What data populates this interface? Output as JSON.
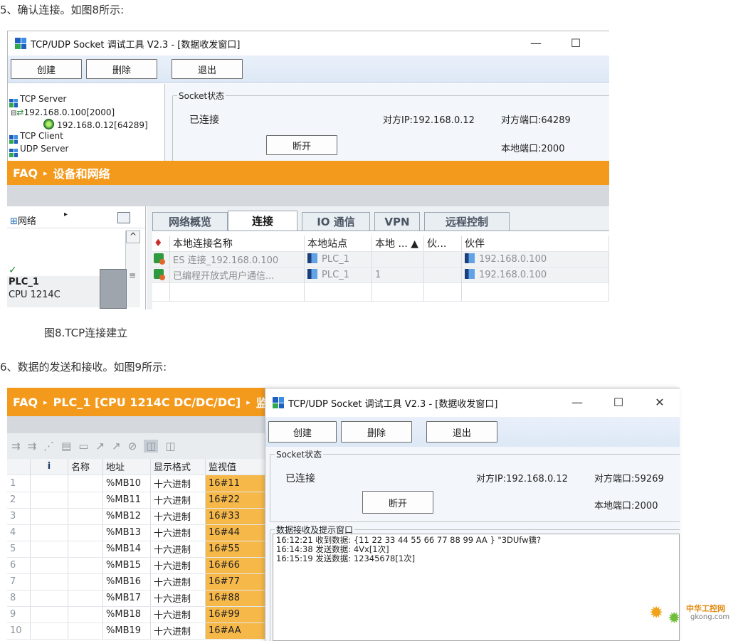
{
  "steps": {
    "step5": "5、确认连接。如图8所示:",
    "caption8": "图8.TCP连接建立",
    "step6": "6、数据的发送和接收。如图9所示:"
  },
  "fig8": {
    "tool": {
      "title": "TCP/UDP Socket 调试工具 V2.3 - [数据收发窗口]",
      "controls": {
        "minimize": "—",
        "maximize": "☐"
      },
      "buttons": {
        "create": "创建",
        "delete": "删除",
        "exit": "退出"
      },
      "tree": {
        "tcp_server": "TCP Server",
        "server_addr": "192.168.0.100[2000]",
        "client_addr": "192.168.0.12[64289]",
        "tcp_client": "TCP Client",
        "udp_server": "UDP Server"
      },
      "socket": {
        "legend": "Socket状态",
        "state": "已连接",
        "remote_ip": "对方IP:192.168.0.12",
        "remote_port": "对方端口:64289",
        "local_port": "本地端口:2000",
        "disconnect": "断开"
      }
    },
    "tia": {
      "breadcrumb": {
        "root": "FAQ",
        "sep": "▸",
        "page": "设备和网络"
      },
      "left": {
        "network_label": "网络",
        "plc_name": "PLC_1",
        "plc_type": "CPU 1214C",
        "check": "✓",
        "arrow": "▸",
        "up": "^",
        "scroll": "≡"
      },
      "tabs": [
        "网络概览",
        "连接",
        "IO 通信",
        "VPN",
        "远程控制"
      ],
      "headers": [
        "本地连接名称",
        "本地站点",
        "本地 ... ▲",
        "伙...",
        "伙伴"
      ],
      "rows": [
        {
          "name": "ES 连接_192.168.0.100",
          "station": "PLC_1",
          "local_id": "",
          "partner_id": "",
          "partner": "192.168.0.100"
        },
        {
          "name": "已编程开放式用户通信...",
          "station": "PLC_1",
          "local_id": "1",
          "partner_id": "",
          "partner": "192.168.0.100"
        }
      ]
    }
  },
  "fig9": {
    "watch": {
      "breadcrumb": {
        "root": "FAQ",
        "sep1": "▸",
        "device": "PLC_1 [CPU 1214C DC/DC/DC]",
        "sep2": "▸",
        "page": "监"
      },
      "headers": [
        "",
        "i",
        "名称",
        "地址",
        "显示格式",
        "监视值"
      ],
      "rows": [
        {
          "n": "1",
          "addr": "%MB10",
          "fmt": "十六进制",
          "val": "16#11"
        },
        {
          "n": "2",
          "addr": "%MB11",
          "fmt": "十六进制",
          "val": "16#22"
        },
        {
          "n": "3",
          "addr": "%MB12",
          "fmt": "十六进制",
          "val": "16#33"
        },
        {
          "n": "4",
          "addr": "%MB13",
          "fmt": "十六进制",
          "val": "16#44"
        },
        {
          "n": "5",
          "addr": "%MB14",
          "fmt": "十六进制",
          "val": "16#55"
        },
        {
          "n": "6",
          "addr": "%MB15",
          "fmt": "十六进制",
          "val": "16#66"
        },
        {
          "n": "7",
          "addr": "%MB16",
          "fmt": "十六进制",
          "val": "16#77"
        },
        {
          "n": "8",
          "addr": "%MB17",
          "fmt": "十六进制",
          "val": "16#88"
        },
        {
          "n": "9",
          "addr": "%MB18",
          "fmt": "十六进制",
          "val": "16#99"
        },
        {
          "n": "10",
          "addr": "%MB19",
          "fmt": "十六进制",
          "val": "16#AA"
        }
      ]
    },
    "tool": {
      "title": "TCP/UDP Socket 调试工具 V2.3 - [数据收发窗口]",
      "controls": {
        "minimize": "—",
        "maximize": "☐",
        "close": "✕"
      },
      "buttons": {
        "create": "创建",
        "delete": "删除",
        "exit": "退出"
      },
      "socket": {
        "legend": "Socket状态",
        "state": "已连接",
        "remote_ip": "对方IP:192.168.0.12",
        "remote_port": "对方端口:59269",
        "local_port": "本地端口:2000",
        "disconnect": "断开"
      },
      "log": {
        "legend": "数据接收及提示窗口",
        "lines": [
          "16:12:21 收到数据: {11 22 33 44 55 66 77 88 99 AA } \"3DUfw獯?",
          "16:14:38 发送数据: 4Vx[1次]",
          "16:15:19 发送数据: 12345678[1次]"
        ]
      }
    },
    "watermark": {
      "cn": "中华工控网",
      "url": "gkong.com"
    }
  },
  "colors": {
    "accent_orange": "#f39a1c",
    "value_highlight": "#f7b84a",
    "toolbar_blue": "#e2ebf7"
  }
}
